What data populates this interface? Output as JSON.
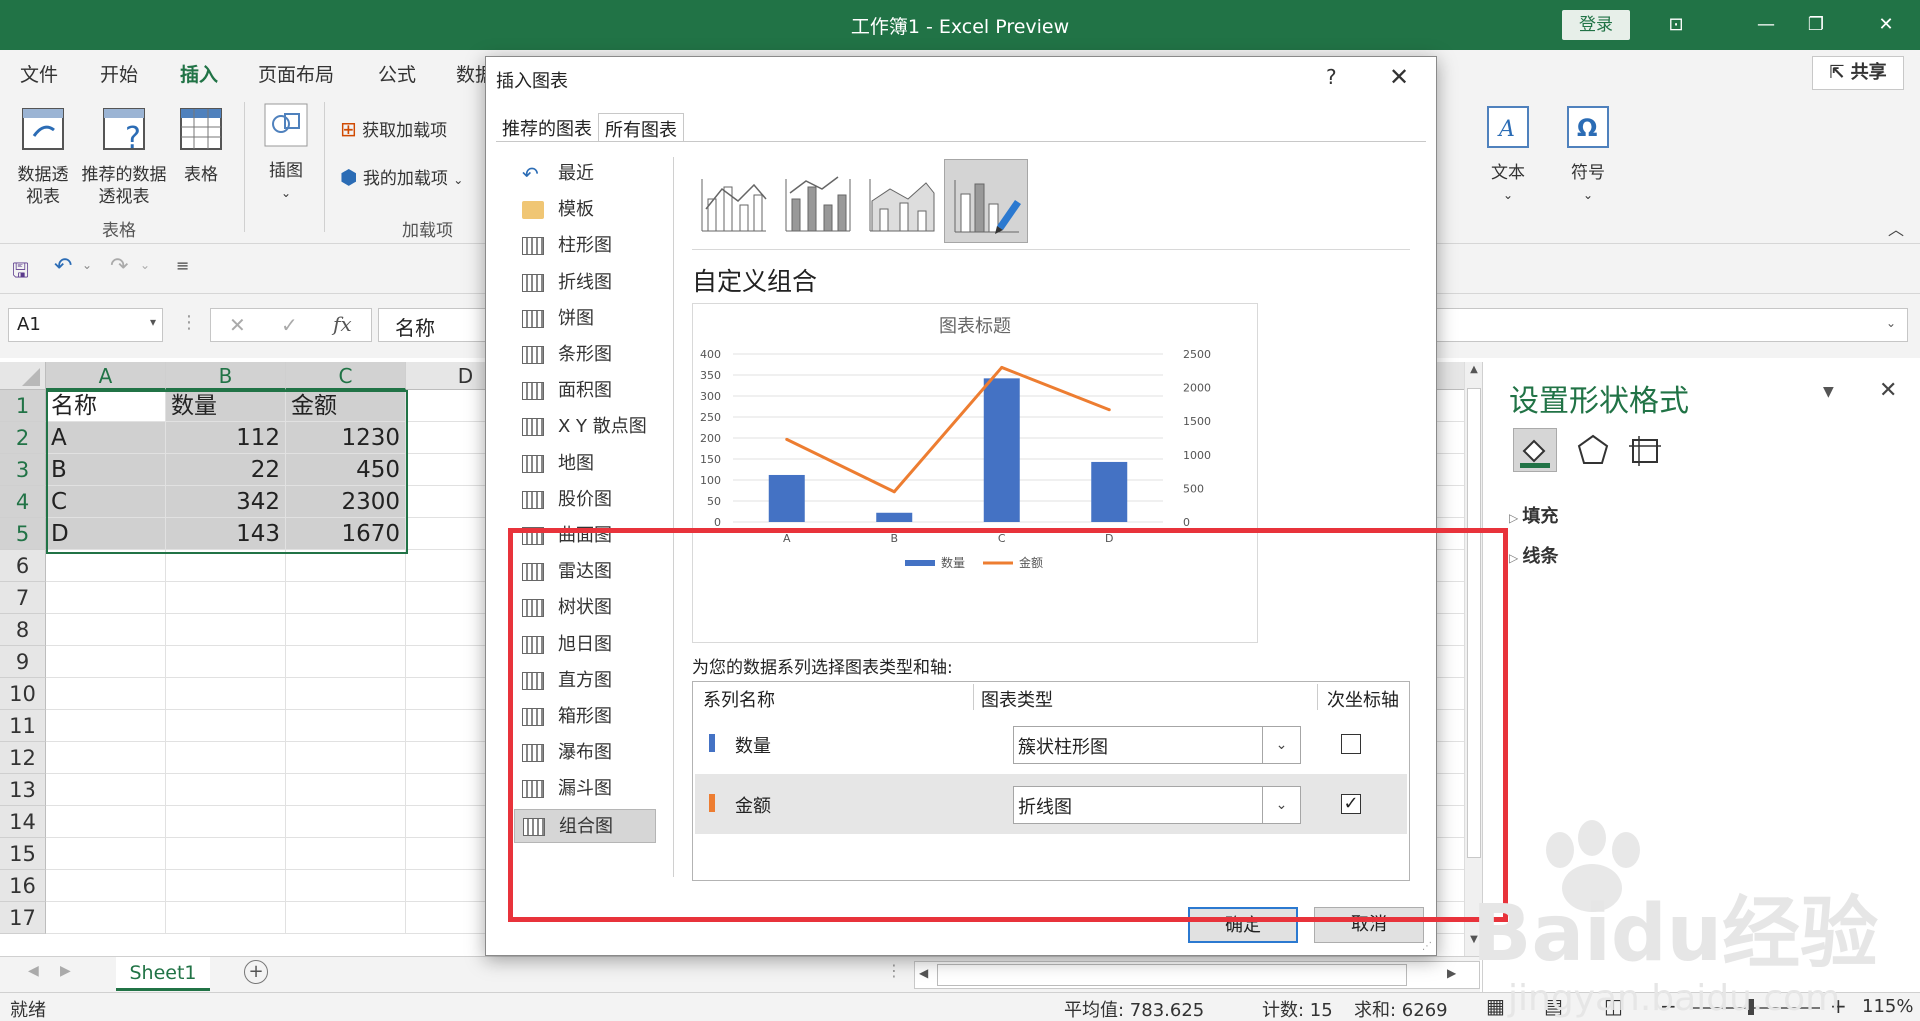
{
  "window": {
    "title": "工作簿1 - Excel Preview",
    "login_label": "登录",
    "share_label": "共享"
  },
  "ribbon_tabs": [
    "文件",
    "开始",
    "插入",
    "页面布局",
    "公式",
    "数据"
  ],
  "ribbon": {
    "pivot_table": "数据透视表",
    "recommended_pivot": "推荐的数据透视表",
    "table": "表格",
    "group_tables": "表格",
    "illustrations": "插图",
    "get_addins": "获取加载项",
    "my_addins": "我的加载项",
    "group_addins": "加载项",
    "text": "文本",
    "symbols": "符号"
  },
  "formula_bar": {
    "name_box": "A1",
    "content": "名称",
    "fx": "fx"
  },
  "grid": {
    "columns": [
      "A",
      "B",
      "C",
      "D"
    ],
    "rows": [
      "1",
      "2",
      "3",
      "4",
      "5",
      "6",
      "7",
      "8",
      "9",
      "10",
      "11",
      "12",
      "13",
      "14",
      "15",
      "16",
      "17"
    ],
    "header_row": [
      "名称",
      "数量",
      "金额"
    ],
    "data": [
      [
        "A",
        "112",
        "1230"
      ],
      [
        "B",
        "22",
        "450"
      ],
      [
        "C",
        "342",
        "2300"
      ],
      [
        "D",
        "143",
        "1670"
      ]
    ]
  },
  "sheet_tab": "Sheet1",
  "status": {
    "ready": "就绪",
    "average": "平均值: 783.625",
    "count": "计数: 15",
    "sum": "求和: 6269",
    "zoom": "115%"
  },
  "pane": {
    "title": "设置形状格式",
    "fill": "填充",
    "line": "线条"
  },
  "dialog": {
    "title": "插入图表",
    "help": "?",
    "tab_recommended": "推荐的图表",
    "tab_all": "所有图表",
    "categories": [
      "最近",
      "模板",
      "柱形图",
      "折线图",
      "饼图",
      "条形图",
      "面积图",
      "X Y 散点图",
      "地图",
      "股价图",
      "曲面图",
      "雷达图",
      "树状图",
      "旭日图",
      "直方图",
      "箱形图",
      "瀑布图",
      "漏斗图",
      "组合图"
    ],
    "combo_title": "自定义组合",
    "series_prompt": "为您的数据系列选择图表类型和轴:",
    "col_series": "系列名称",
    "col_type": "图表类型",
    "col_secondary": "次坐标轴",
    "series": [
      {
        "name": "数量",
        "type": "簇状柱形图",
        "secondary": false,
        "color": "#4472C4"
      },
      {
        "name": "金额",
        "type": "折线图",
        "secondary": true,
        "color": "#ED7D31"
      }
    ],
    "ok": "确定",
    "cancel": "取消"
  },
  "chart_data": {
    "type": "bar",
    "title": "图表标题",
    "categories": [
      "A",
      "B",
      "C",
      "D"
    ],
    "series": [
      {
        "name": "数量",
        "type": "bar",
        "axis": "primary",
        "color": "#4472C4",
        "values": [
          112,
          22,
          342,
          143
        ]
      },
      {
        "name": "金额",
        "type": "line",
        "axis": "secondary",
        "color": "#ED7D31",
        "values": [
          1230,
          450,
          2300,
          1670
        ]
      }
    ],
    "ylim": [
      0,
      400
    ],
    "y_ticks": [
      "400",
      "350",
      "300",
      "250",
      "200",
      "150",
      "100",
      "50",
      "0"
    ],
    "y2lim": [
      0,
      2500
    ],
    "y2_ticks": [
      "2500",
      "2000",
      "1500",
      "1000",
      "500",
      "0"
    ],
    "legend": "bottom"
  },
  "watermark": {
    "brand": "Baidu经验",
    "url": "jingyan.baidu.com"
  }
}
